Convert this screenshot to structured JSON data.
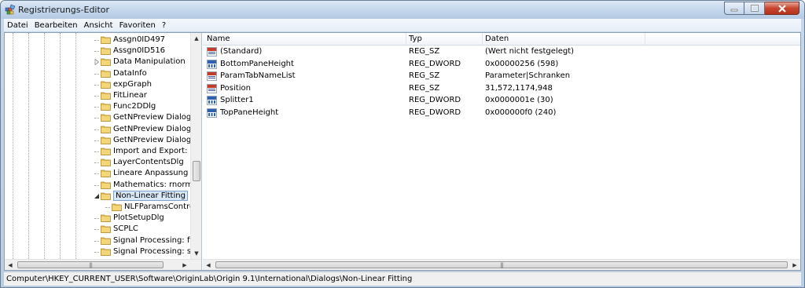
{
  "window": {
    "title": "Registrierungs-Editor"
  },
  "menu": [
    "Datei",
    "Bearbeiten",
    "Ansicht",
    "Favoriten",
    "?"
  ],
  "tree": {
    "items": [
      {
        "label": "Assgn0ID497",
        "expandable": false
      },
      {
        "label": "Assgn0ID516",
        "expandable": false
      },
      {
        "label": "Data Manipulation",
        "expandable": true
      },
      {
        "label": "DataInfo",
        "expandable": false
      },
      {
        "label": "expGraph",
        "expandable": false
      },
      {
        "label": "FitLinear",
        "expandable": false
      },
      {
        "label": "Func2DDlg",
        "expandable": false
      },
      {
        "label": "GetNPreview Dialog:e",
        "expandable": false
      },
      {
        "label": "GetNPreview Dialog:ff",
        "expandable": false
      },
      {
        "label": "GetNPreview Dialog:sı",
        "expandable": false
      },
      {
        "label": "Import and Export: exp",
        "expandable": false
      },
      {
        "label": "LayerContentsDlg",
        "expandable": false
      },
      {
        "label": "Lineare Anpassung",
        "expandable": false
      },
      {
        "label": "Mathematics: rnormali",
        "expandable": false
      },
      {
        "label": "Non-Linear Fitting",
        "expandable": true,
        "expanded": true,
        "selected": true
      },
      {
        "label": "NLFParamsControl",
        "expandable": false,
        "child": true
      },
      {
        "label": "PlotSetupDlg",
        "expandable": false
      },
      {
        "label": "SCPLC",
        "expandable": false
      },
      {
        "label": "Signal Processing: fft_f",
        "expandable": false
      },
      {
        "label": "Signal Processing: smc",
        "expandable": false
      }
    ]
  },
  "values": {
    "columns": [
      "Name",
      "Typ",
      "Daten"
    ],
    "rows": [
      {
        "icon": "string-value-icon",
        "name": "(Standard)",
        "type": "REG_SZ",
        "data": "(Wert nicht festgelegt)"
      },
      {
        "icon": "binary-value-icon",
        "name": "BottomPaneHeight",
        "type": "REG_DWORD",
        "data": "0x00000256 (598)"
      },
      {
        "icon": "string-value-icon",
        "name": "ParamTabNameList",
        "type": "REG_SZ",
        "data": "Parameter|Schranken"
      },
      {
        "icon": "string-value-icon",
        "name": "Position",
        "type": "REG_SZ",
        "data": "31,572,1174,948"
      },
      {
        "icon": "binary-value-icon",
        "name": "Splitter1",
        "type": "REG_DWORD",
        "data": "0x0000001e (30)"
      },
      {
        "icon": "binary-value-icon",
        "name": "TopPaneHeight",
        "type": "REG_DWORD",
        "data": "0x000000f0 (240)"
      }
    ]
  },
  "statusbar": {
    "path": "Computer\\HKEY_CURRENT_USER\\Software\\OriginLab\\Origin 9.1\\International\\Dialogs\\Non-Linear Fitting"
  },
  "colors": {
    "selection": "#d8e8f8",
    "folder": "#e8c15a",
    "close_button": "#c8452f"
  }
}
